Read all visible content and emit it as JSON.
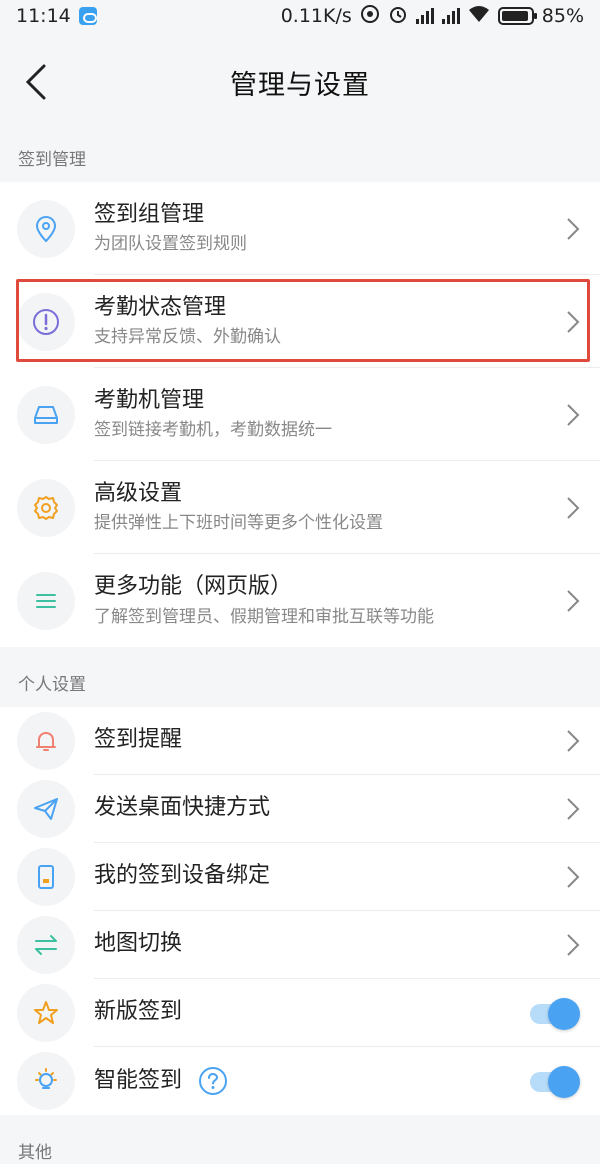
{
  "status_bar": {
    "time": "11:14",
    "net_speed": "0.11K/s",
    "battery": "85%"
  },
  "nav": {
    "title": "管理与设置"
  },
  "sections": {
    "checkin_management": {
      "header": "签到管理",
      "items": [
        {
          "title": "签到组管理",
          "subtitle": "为团队设置签到规则",
          "icon": "location-pin-icon"
        },
        {
          "title": "考勤状态管理",
          "subtitle": "支持异常反馈、外勤确认",
          "icon": "exclamation-circle-icon"
        },
        {
          "title": "考勤机管理",
          "subtitle": "签到链接考勤机，考勤数据统一",
          "icon": "tray-icon"
        },
        {
          "title": "高级设置",
          "subtitle": "提供弹性上下班时间等更多个性化设置",
          "icon": "gear-icon"
        },
        {
          "title": "更多功能（网页版）",
          "subtitle": "了解签到管理员、假期管理和审批互联等功能",
          "icon": "menu-lines-icon"
        }
      ]
    },
    "personal_settings": {
      "header": "个人设置",
      "items": [
        {
          "title": "签到提醒",
          "icon": "bell-icon"
        },
        {
          "title": "发送桌面快捷方式",
          "icon": "paper-plane-icon"
        },
        {
          "title": "我的签到设备绑定",
          "icon": "device-icon"
        },
        {
          "title": "地图切换",
          "icon": "swap-arrows-icon"
        },
        {
          "title": "新版签到",
          "icon": "star-icon",
          "toggle": true
        },
        {
          "title": "智能签到",
          "icon": "lightbulb-icon",
          "toggle": true
        }
      ]
    },
    "other": {
      "header": "其他"
    }
  },
  "colors": {
    "accent_blue": "#4aa3f2",
    "highlight_red": "#e04a3c",
    "orange": "#f0a020",
    "green": "#3cc0a0",
    "coral": "#f08070"
  }
}
